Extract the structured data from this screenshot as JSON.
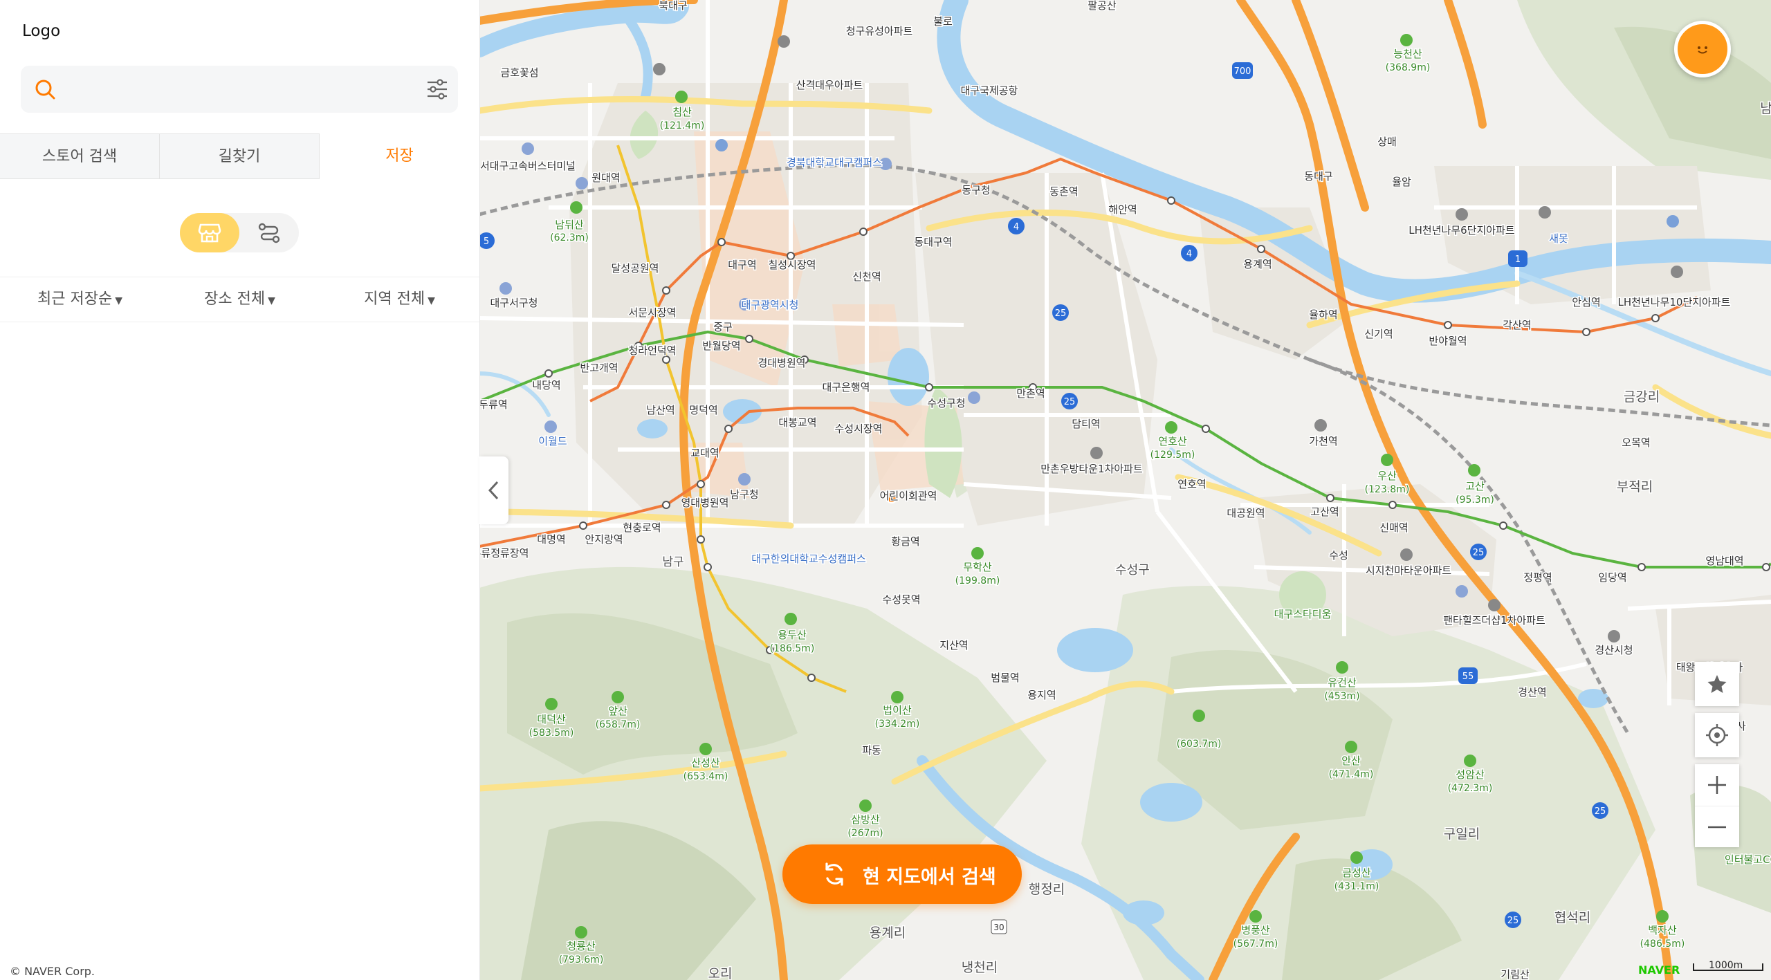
{
  "sidebar": {
    "logo": "Logo",
    "search": {
      "placeholder": ""
    },
    "tabs": [
      {
        "label": "스토어 검색",
        "active": false
      },
      {
        "label": "길찾기",
        "active": false
      },
      {
        "label": "저장",
        "active": true
      }
    ],
    "view_toggle": {
      "selected": "store-icon",
      "options": [
        "store-icon",
        "route-icon"
      ]
    },
    "filters": [
      {
        "label": "최근 저장순"
      },
      {
        "label": "장소 전체"
      },
      {
        "label": "지역 전체"
      }
    ],
    "copyright": "© NAVER Corp."
  },
  "map": {
    "search_here_label": "현 지도에서 검색",
    "provider": "NAVER",
    "scale_label": "1000m",
    "labels": [
      "북대구",
      "청구유성아파트",
      "불로",
      "팔공산",
      "금호꽃섬",
      "산격대우아파트",
      "대구국제공항",
      "능천산",
      "(368.9m)",
      "침산",
      "(121.4m)",
      "서대구고속버스터미널",
      "원대역",
      "경북대학교대구캠퍼스",
      "동구청",
      "동촌역",
      "해안역",
      "상매",
      "동대구",
      "율암",
      "LH천년나무6단지아파트",
      "새못",
      "남뒤산",
      "(62.3m)",
      "달성공원역",
      "대구역",
      "칠성시장역",
      "신천역",
      "동대구역",
      "용계역",
      "대구광역시청",
      "대구서구청",
      "서문시장역",
      "중구",
      "반월당역",
      "경대병원역",
      "율하역",
      "신기역",
      "반야월역",
      "각산역",
      "안심역",
      "LH천년나무10단지아파트",
      "청라언덕역",
      "반고개역",
      "대구은행역",
      "수성구청",
      "만촌역",
      "담티역",
      "내당역",
      "두류역",
      "남산역",
      "명덕역",
      "대봉교역",
      "수성시장역",
      "가천역",
      "금강리",
      "이월드",
      "교대역",
      "만촌우방타운1차아파트",
      "연호산",
      "(129.5m)",
      "연호역",
      "우산",
      "(123.8m)",
      "고산",
      "(95.3m)",
      "부적리",
      "오목역",
      "남구청",
      "영대병원역",
      "어린이회관역",
      "대공원역",
      "고산역",
      "신매역",
      "정평역",
      "임당역",
      "영남대역",
      "현충로역",
      "대명역",
      "안지랑역",
      "두류정류장역",
      "대구한의대학교수성캠퍼스",
      "황금역",
      "남구",
      "무학산",
      "(199.8m)",
      "수성구",
      "수성",
      "시지천마타운아파트",
      "수성못역",
      "대구스타디움",
      "팬타힐즈더샵1차아파트",
      "경산시청",
      "용두산",
      "(186.5m)",
      "지산역",
      "태왕드하이츠아",
      "범물역",
      "용지역",
      "경산역",
      "대덕산",
      "(583.5m)",
      "앞산",
      "(658.7m)",
      "법이산",
      "(334.2m)",
      "유건산",
      "(453m)",
      "(603.7m)",
      "경산사",
      "산성산",
      "(653.4m)",
      "파동",
      "안산",
      "(471.4m)",
      "성암산",
      "(472.3m)",
      "구일리",
      "인터불고CC",
      "삼방산",
      "(267m)",
      "행정리",
      "금성산",
      "(431.1m)",
      "용계리",
      "병풍산",
      "(567.7m)",
      "협석리",
      "백자산",
      "(486.5m)",
      "청룡산",
      "(793.6m)",
      "냉천리",
      "오리",
      "기림산",
      "남"
    ]
  },
  "colors": {
    "accent": "#ff7a00",
    "toggle_selected": "#ffd666",
    "river": "#a9d3f2",
    "highway": "#f7a03b",
    "line1": "#f07a3a",
    "line2": "#5ab440",
    "line3": "#f2c42f",
    "naver_green": "#1ec800"
  },
  "controls": {
    "star": "star-icon",
    "locate": "locate-icon",
    "zoom_in": "plus-icon",
    "zoom_out": "minus-icon"
  }
}
